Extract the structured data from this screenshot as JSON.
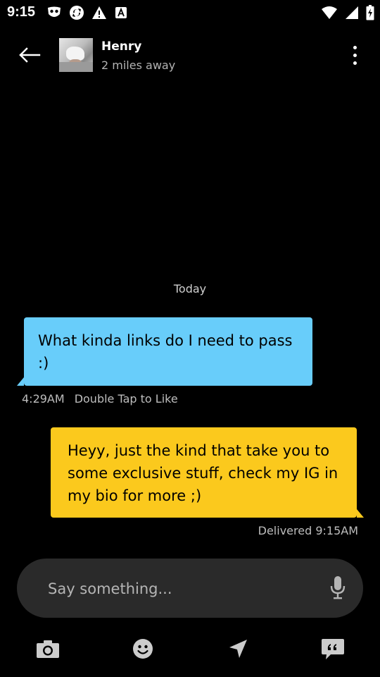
{
  "status_bar": {
    "time": "9:15"
  },
  "header": {
    "contact_name": "Henry",
    "contact_distance": "2 miles away"
  },
  "conversation": {
    "date_divider": "Today",
    "messages": [
      {
        "direction": "incoming",
        "text": "What kinda links do I need to pass :)",
        "time": "4:29AM",
        "hint": "Double Tap to Like",
        "color": "#68cdfa"
      },
      {
        "direction": "outgoing",
        "text": "Heyy, just the kind that take you to some exclusive stuff, check my IG in my bio for more ;)",
        "status": "Delivered 9:15AM",
        "color": "#fbc91d"
      }
    ]
  },
  "composer": {
    "placeholder": "Say something..."
  },
  "toolbar": {
    "icons": [
      "camera-icon",
      "emoji-icon",
      "location-icon",
      "quick-replies-icon"
    ]
  },
  "theme": {
    "background": "#000000",
    "incoming_bubble": "#68cdfa",
    "outgoing_bubble": "#fbc91d",
    "composer_bg": "#2a2a2a"
  }
}
